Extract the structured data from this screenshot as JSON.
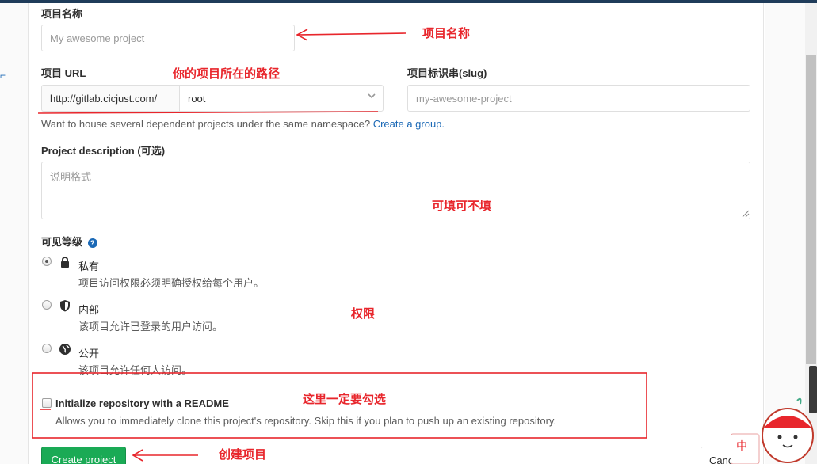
{
  "form": {
    "project_name_label": "项目名称",
    "project_name_placeholder": "My awesome project",
    "project_url_label": "项目 URL",
    "url_prefix": "http://gitlab.cicjust.com/",
    "namespace_value": "root",
    "slug_label": "项目标识串(slug)",
    "slug_placeholder": "my-awesome-project",
    "namespace_help": "Want to house several dependent projects under the same namespace?",
    "create_group_link": "Create a group.",
    "description_label": "Project description (可选)",
    "description_placeholder": "说明格式",
    "visibility_label": "可见等级",
    "visibility_help_icon": "?",
    "visibility_options": [
      {
        "title": "私有",
        "desc": "项目访问权限必须明确授权给每个用户。",
        "icon": "lock-icon",
        "checked": true
      },
      {
        "title": "内部",
        "desc": "该项目允许已登录的用户访问。",
        "icon": "shield-icon",
        "checked": false
      },
      {
        "title": "公开",
        "desc": "该项目允许任何人访问。",
        "icon": "globe-icon",
        "checked": false
      }
    ],
    "readme_label": "Initialize repository with a README",
    "readme_desc": "Allows you to immediately clone this project's repository. Skip this if you plan to push up an existing repository.",
    "create_button": "Create project",
    "cancel_button": "Cancel"
  },
  "annotations": {
    "name": "项目名称",
    "path": "你的项目所在的路径",
    "optional": "可填可不填",
    "permission": "权限",
    "must_check": "这里一定要勾选",
    "create": "创建项目"
  },
  "colors": {
    "annotation": "#e8262c",
    "primary_button": "#1aaa55",
    "link": "#1b69b6",
    "topbar": "#1f3c5a"
  },
  "sticker": {
    "text": "中"
  }
}
